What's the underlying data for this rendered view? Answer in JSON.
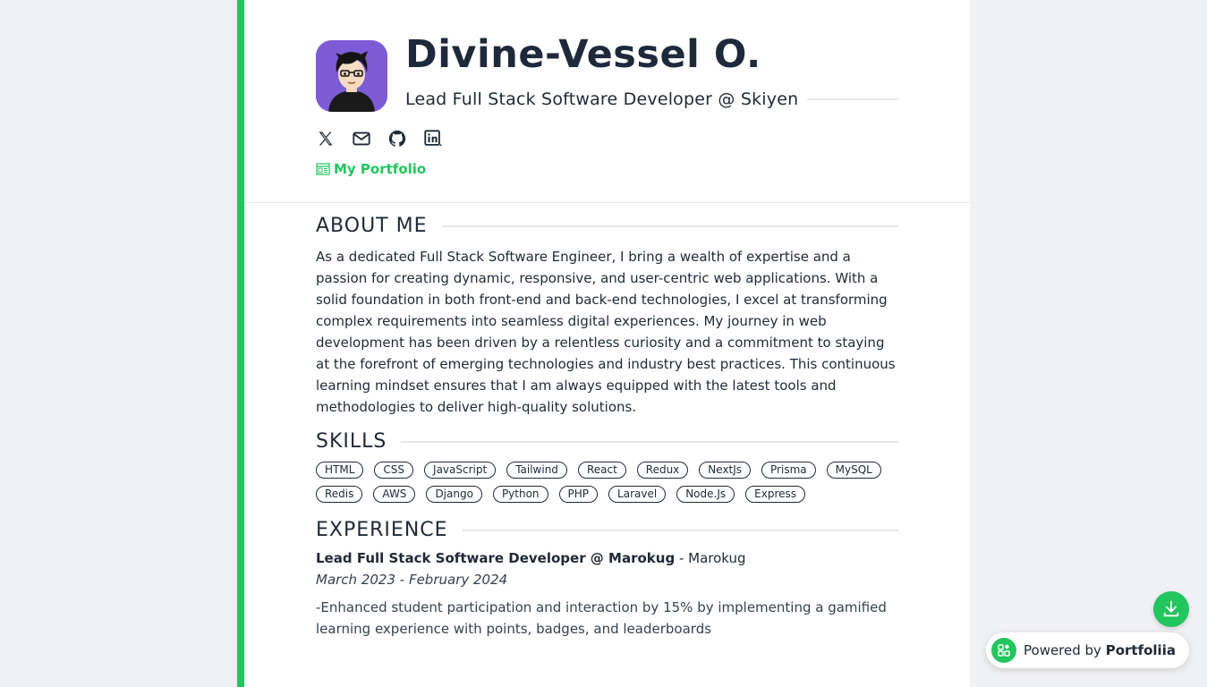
{
  "profile": {
    "name": "Divine-Vessel O.",
    "headline": "Lead Full Stack Software Developer @ Skiyen",
    "portfolio_label": "My Portfolio"
  },
  "socials": [
    {
      "icon": "x-twitter-icon"
    },
    {
      "icon": "mail-icon"
    },
    {
      "icon": "github-icon"
    },
    {
      "icon": "linkedin-icon"
    }
  ],
  "about": {
    "title": "ABOUT ME",
    "text": "As a dedicated Full Stack Software Engineer, I bring a wealth of expertise and a passion for creating dynamic, responsive, and user-centric web applications. With a solid foundation in both front-end and back-end technologies, I excel at transforming complex requirements into seamless digital experiences. My journey in web development has been driven by a relentless curiosity and a commitment to staying at the forefront of emerging technologies and industry best practices. This continuous learning mindset ensures that I am always equipped with the latest tools and methodologies to deliver high-quality solutions."
  },
  "skills": {
    "title": "SKILLS",
    "items": [
      "HTML",
      "CSS",
      "JavaScript",
      "Tailwind",
      "React",
      "Redux",
      "NextJs",
      "Prisma",
      "MySQL",
      "Redis",
      "AWS",
      "Django",
      "Python",
      "PHP",
      "Laravel",
      "Node.Js",
      "Express"
    ]
  },
  "experience": {
    "title": "EXPERIENCE",
    "jobs": [
      {
        "role": "Lead Full Stack Software Developer @ Marokug",
        "separator": " - ",
        "company": "Marokug",
        "dates": "March 2023 - February 2024",
        "description": "-Enhanced student participation and interaction by 15% by implementing a gamified learning experience with points, badges, and leaderboards"
      }
    ]
  },
  "widgets": {
    "powered_prefix": "Powered by ",
    "powered_brand": "Portfoliia"
  },
  "colors": {
    "accent": "#22c55e",
    "text": "#1f2937",
    "avatar_bg": "#7c5cd6"
  }
}
